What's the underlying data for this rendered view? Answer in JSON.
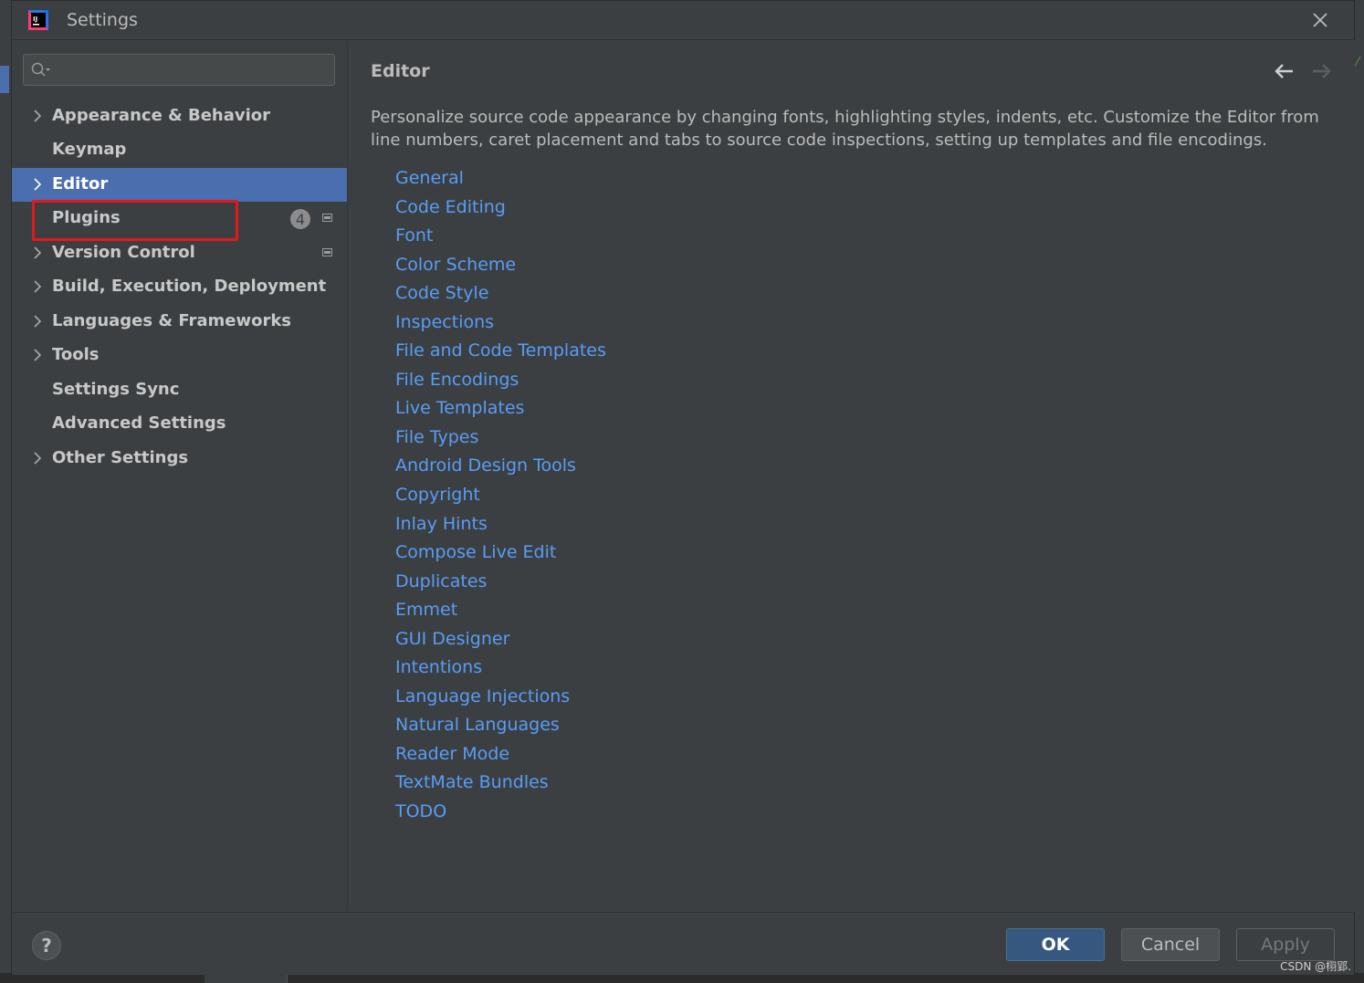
{
  "window": {
    "title": "Settings",
    "app_icon": "intellij-idea-icon",
    "close_icon": "close-icon"
  },
  "sidebar": {
    "search": {
      "value": "",
      "placeholder": "",
      "icon": "search-icon"
    },
    "items": [
      {
        "label": "Appearance & Behavior",
        "expandable": true
      },
      {
        "label": "Keymap",
        "expandable": false
      },
      {
        "label": "Editor",
        "expandable": true,
        "selected": true
      },
      {
        "label": "Plugins",
        "expandable": false,
        "badge": "4",
        "highlighted": true
      },
      {
        "label": "Version Control",
        "expandable": true
      },
      {
        "label": "Build, Execution, Deployment",
        "expandable": true
      },
      {
        "label": "Languages & Frameworks",
        "expandable": true
      },
      {
        "label": "Tools",
        "expandable": true
      },
      {
        "label": "Settings Sync",
        "expandable": false
      },
      {
        "label": "Advanced Settings",
        "expandable": false
      },
      {
        "label": "Other Settings",
        "expandable": true
      }
    ]
  },
  "content": {
    "title": "Editor",
    "description": "Personalize source code appearance by changing fonts, highlighting styles, indents, etc. Customize the Editor from line numbers, caret placement and tabs to source code inspections, setting up templates and file encodings.",
    "links": [
      "General",
      "Code Editing",
      "Font",
      "Color Scheme",
      "Code Style",
      "Inspections",
      "File and Code Templates",
      "File Encodings",
      "Live Templates",
      "File Types",
      "Android Design Tools",
      "Copyright",
      "Inlay Hints",
      "Compose Live Edit",
      "Duplicates",
      "Emmet",
      "GUI Designer",
      "Intentions",
      "Language Injections",
      "Natural Languages",
      "Reader Mode",
      "TextMate Bundles",
      "TODO"
    ]
  },
  "footer": {
    "help_label": "?",
    "ok_label": "OK",
    "cancel_label": "Cancel",
    "apply_label": "Apply"
  },
  "watermark": "CSDN @栩郢.",
  "colors": {
    "background": "#3c3f41",
    "selection": "#4b6eaf",
    "link": "#589df6",
    "highlight_box": "#e3181b",
    "ok_button": "#365880"
  }
}
